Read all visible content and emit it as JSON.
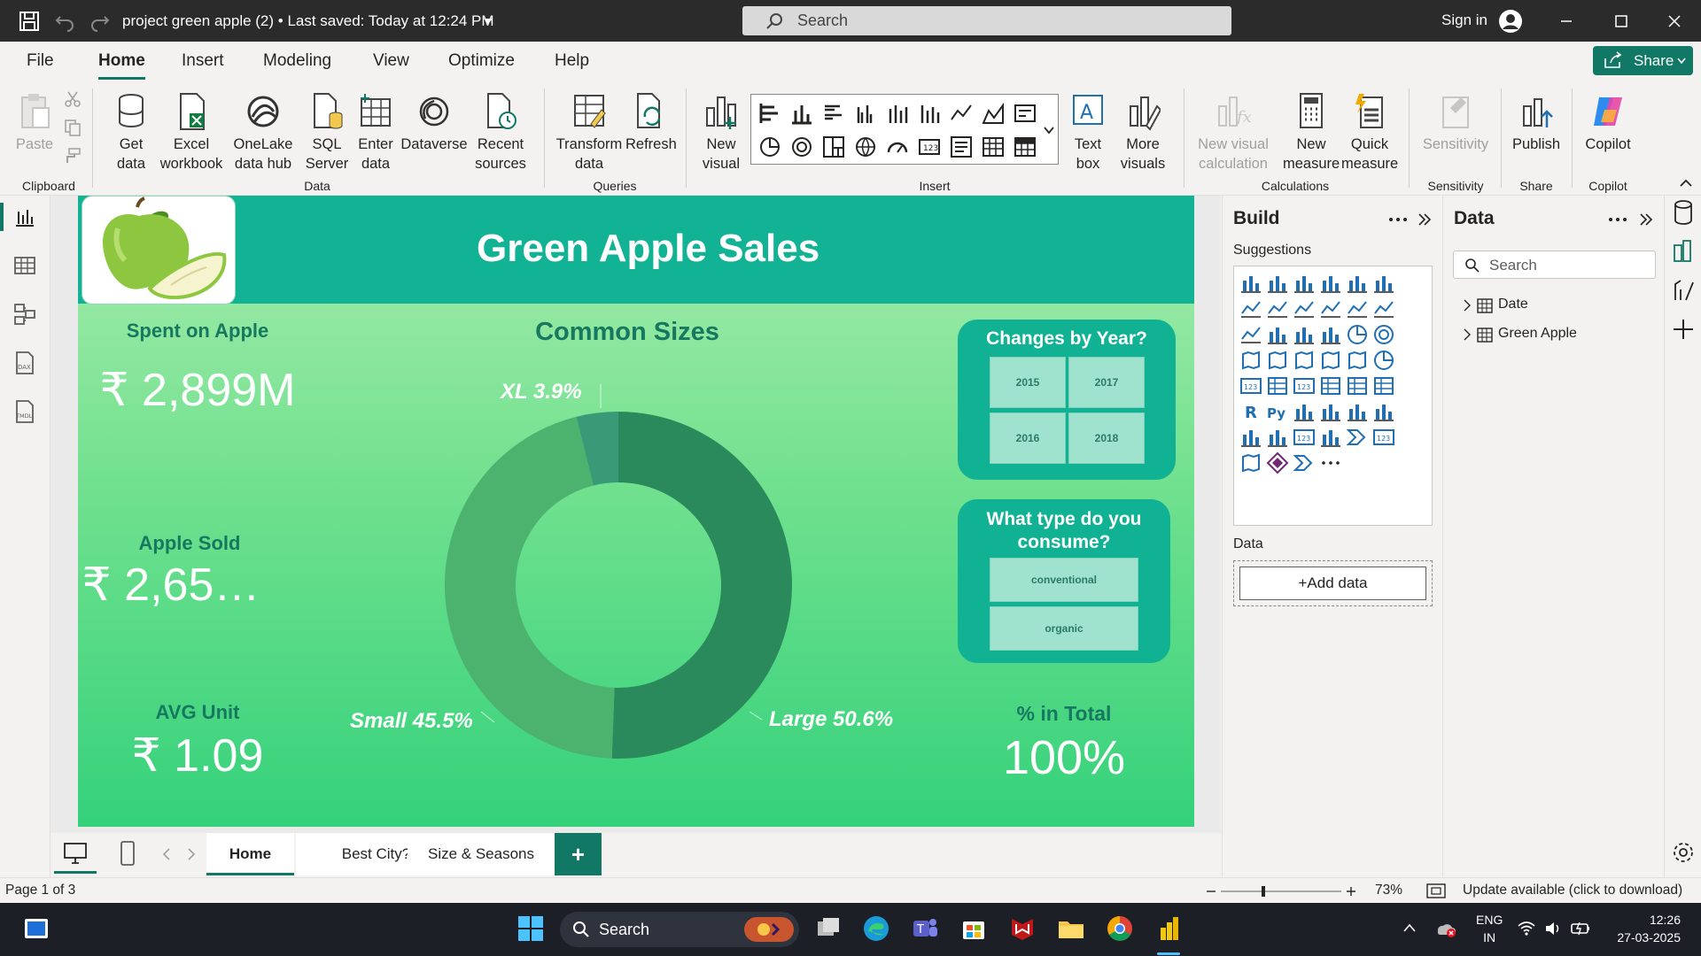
{
  "titlebar": {
    "title": "project green apple (2) • Last saved: Today at 12:24 PM",
    "search_placeholder": "Search",
    "signin": "Sign in"
  },
  "menu": {
    "tabs": [
      "File",
      "Home",
      "Insert",
      "Modeling",
      "View",
      "Optimize",
      "Help"
    ],
    "active": "Home",
    "share": "Share"
  },
  "ribbon": {
    "clipboard": {
      "paste": "Paste",
      "group": "Clipboard"
    },
    "data": {
      "get_data": "Get data",
      "excel": "Excel workbook",
      "onelake": "OneLake data hub",
      "sql": "SQL Server",
      "enter": "Enter data",
      "dataverse": "Dataverse",
      "recent": "Recent sources",
      "group": "Data"
    },
    "queries": {
      "transform": "Transform data",
      "refresh": "Refresh",
      "group": "Queries"
    },
    "insert": {
      "new_visual": "New visual",
      "text_box": "Text box",
      "more_visuals": "More visuals",
      "group": "Insert"
    },
    "calculations": {
      "new_visual_calc": "New visual calculation",
      "new_measure": "New measure",
      "quick_measure": "Quick measure",
      "group": "Calculations"
    },
    "sensitivity": {
      "label": "Sensitivity",
      "group": "Sensitivity"
    },
    "share": {
      "publish": "Publish",
      "group": "Share"
    },
    "copilot": {
      "label": "Copilot",
      "group": "Copilot"
    }
  },
  "report": {
    "title": "Green Apple Sales",
    "kpis": [
      {
        "label": "Spent on Apple",
        "value": "₹ 2,899M"
      },
      {
        "label": "Apple Sold",
        "value": "₹ 2,65…"
      },
      {
        "label": "AVG Unit",
        "value": "₹ 1.09"
      }
    ],
    "donut_title": "Common Sizes",
    "year_slicer": {
      "title": "Changes by Year?",
      "items": [
        "2015",
        "2017",
        "2016",
        "2018"
      ]
    },
    "type_slicer": {
      "title": "What type do you consume?",
      "items": [
        "conventional",
        "organic"
      ]
    },
    "pct_total": {
      "label": "% in Total",
      "value": "100%"
    },
    "colors": {
      "header": "#12b294",
      "donut_large": "#2a8a5c",
      "donut_small": "#4cb36e",
      "donut_xl": "#3a9a78"
    }
  },
  "chart_data": {
    "type": "pie",
    "title": "Common Sizes",
    "categories": [
      "Large",
      "Small",
      "XL"
    ],
    "values": [
      50.6,
      45.5,
      3.9
    ],
    "labels": [
      "Large 50.6%",
      "Small 45.5%",
      "XL 3.9%"
    ],
    "donut": true
  },
  "pages": {
    "tabs": [
      "Home",
      "Best City?",
      "Size & Seasons"
    ],
    "active": "Home",
    "add": "+"
  },
  "build": {
    "title": "Build",
    "suggestions": "Suggestions",
    "data_label": "Data",
    "add_data": "+Add data"
  },
  "datapane": {
    "title": "Data",
    "search_placeholder": "Search",
    "tables": [
      "Date",
      "Green Apple"
    ]
  },
  "status": {
    "page": "Page 1 of 3",
    "zoom": "73%",
    "update": "Update available (click to download)"
  },
  "taskbar": {
    "search": "Search",
    "lang1": "ENG",
    "lang2": "IN",
    "time": "12:26",
    "date": "27-03-2025"
  }
}
